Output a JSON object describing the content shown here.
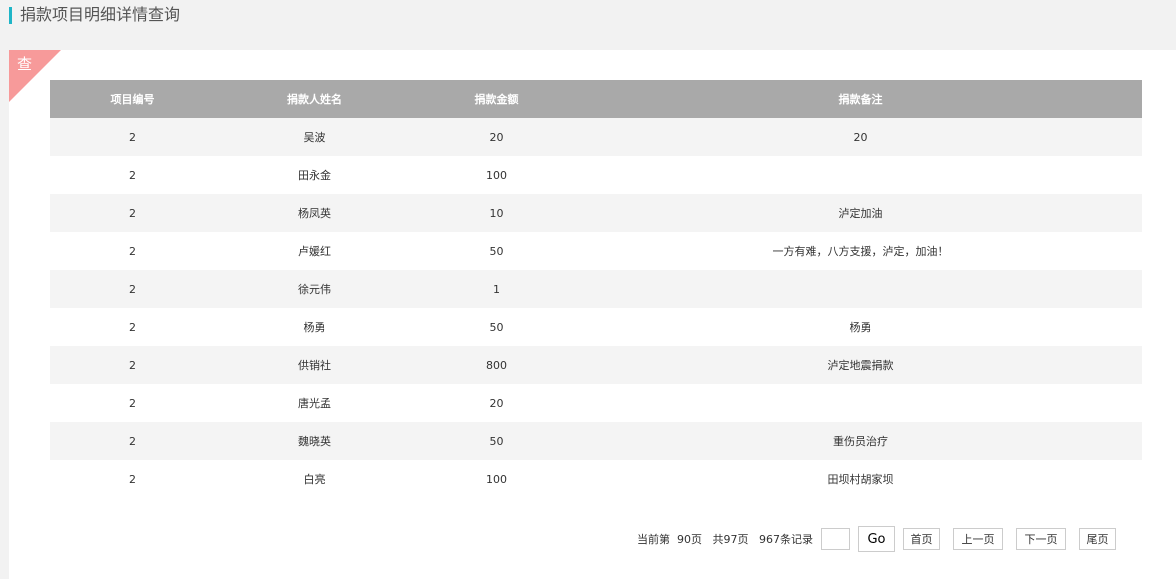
{
  "page": {
    "title": "捐款项目明细详情查询"
  },
  "panel": {
    "corner_label": "查"
  },
  "table": {
    "headers": [
      "项目编号",
      "捐款人姓名",
      "捐款金额",
      "捐款备注"
    ],
    "rows": [
      [
        "2",
        "吴波",
        "20",
        "20"
      ],
      [
        "2",
        "田永金",
        "100",
        ""
      ],
      [
        "2",
        "杨凤英",
        "10",
        "泸定加油"
      ],
      [
        "2",
        "卢媛红",
        "50",
        "一方有难，八方支援，泸定，加油！"
      ],
      [
        "2",
        "徐元伟",
        "1",
        ""
      ],
      [
        "2",
        "杨勇",
        "50",
        "杨勇"
      ],
      [
        "2",
        "供销社",
        "800",
        "泸定地震捐款"
      ],
      [
        "2",
        "唐光孟",
        "20",
        ""
      ],
      [
        "2",
        "魏晓英",
        "50",
        "重伤员治疗"
      ],
      [
        "2",
        "白亮",
        "100",
        "田坝村胡家坝"
      ]
    ]
  },
  "pager": {
    "info": "当前第  90页   共97页   967条记录",
    "input_value": "",
    "go_label": "Go",
    "first_label": "首页",
    "prev_label": "上一页",
    "next_label": "下一页",
    "last_label": "尾页"
  },
  "colors": {
    "accent": "#1fb5c7",
    "corner": "#f79a9a",
    "header_bg": "#a9a9a9",
    "stripe": "#f4f4f4"
  }
}
